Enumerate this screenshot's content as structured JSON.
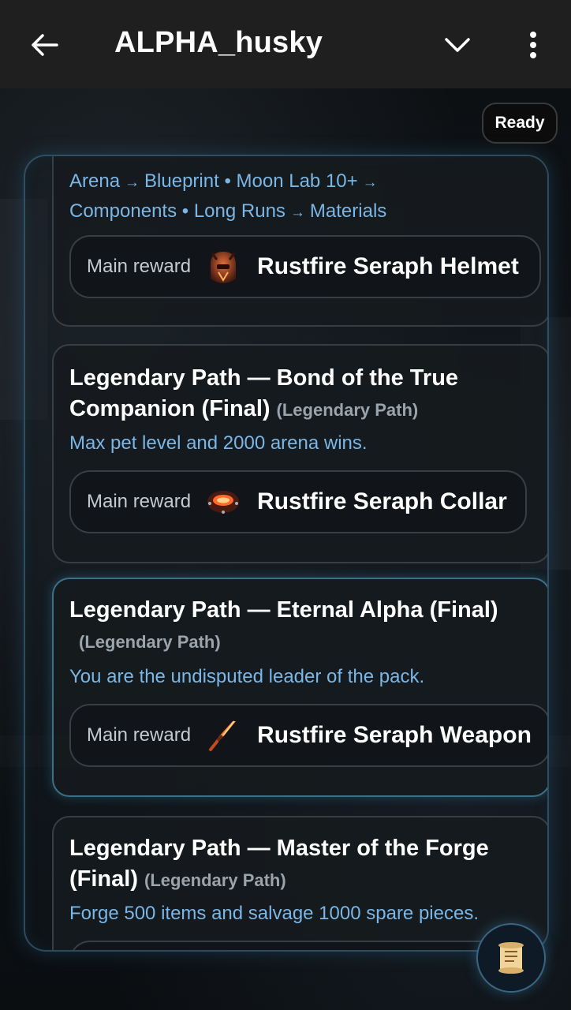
{
  "header": {
    "title": "ALPHA_husky",
    "back_icon": "arrow-left-icon",
    "dropdown_icon": "chevron-down-icon",
    "more_icon": "more-vertical-icon"
  },
  "status": {
    "badge": "Ready"
  },
  "route_card": {
    "steps": [
      "Arena",
      "Blueprint",
      "Moon Lab 10+",
      "Components",
      "Long Runs",
      "Materials"
    ],
    "arrow": "→",
    "dot": "•",
    "reward_label": "Main reward",
    "reward_name": "Rustfire Seraph Helmet",
    "reward_icon": "helmet-icon"
  },
  "quests": [
    {
      "title": "Legendary Path — Bond of the True Companion (Final)",
      "tag": "(Legendary Path)",
      "description": "Max pet level and 2000 arena wins.",
      "reward_label": "Main reward",
      "reward_name": "Rustfire Seraph Collar",
      "reward_icon": "collar-icon"
    },
    {
      "title": "Legendary Path — Eternal Alpha (Final)",
      "tag": "(Legendary Path)",
      "description": "You are the undisputed leader of the pack.",
      "reward_label": "Main reward",
      "reward_name": "Rustfire Seraph Weapon",
      "reward_icon": "weapon-icon"
    },
    {
      "title": "Legendary Path — Master of the Forge (Final)",
      "tag": "(Legendary Path)",
      "description": "Forge 500 items and salvage 1000 spare pieces."
    }
  ],
  "fab": {
    "icon": "scroll-icon"
  },
  "colors": {
    "accent_text": "#7ab6e6",
    "glow": "#3c8cbe",
    "topbar": "#1f1f1f"
  }
}
